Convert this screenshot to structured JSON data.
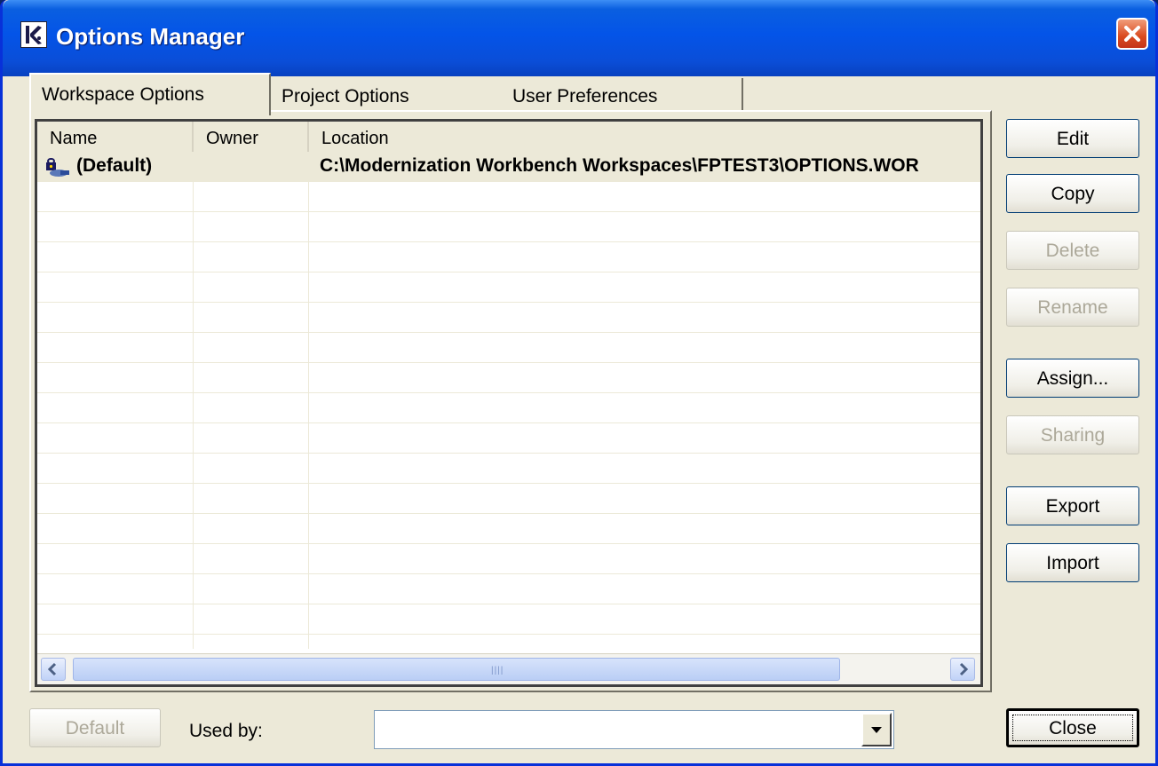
{
  "window": {
    "title": "Options Manager"
  },
  "tabs": [
    {
      "label": "Workspace Options",
      "active": true
    },
    {
      "label": "Project Options",
      "active": false
    },
    {
      "label": "User Preferences",
      "active": false
    }
  ],
  "list": {
    "columns": [
      "Name",
      "Owner",
      "Location"
    ],
    "rows": [
      {
        "name": "(Default)",
        "owner": "",
        "location": "C:\\Modernization Workbench Workspaces\\FPTEST3\\OPTIONS.WOR",
        "icon": "lock-user-icon",
        "selected": true
      }
    ]
  },
  "buttons": {
    "edit": "Edit",
    "copy": "Copy",
    "delete": "Delete",
    "rename": "Rename",
    "assign": "Assign...",
    "sharing": "Sharing",
    "export": "Export",
    "import": "Import",
    "default": "Default",
    "close": "Close"
  },
  "used_by": {
    "label": "Used by:",
    "value": ""
  },
  "colors": {
    "titlebar": "#0454e8",
    "window_bg": "#ece9d8",
    "close_button": "#d94a1f"
  }
}
